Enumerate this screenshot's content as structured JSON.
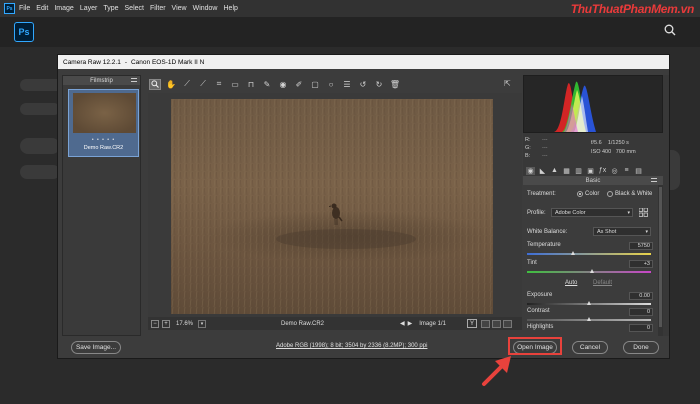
{
  "app": {
    "menu": [
      "File",
      "Edit",
      "Image",
      "Layer",
      "Type",
      "Select",
      "Filter",
      "View",
      "Window",
      "Help"
    ],
    "logo": "Ps",
    "watermark": "ThuThuatPhanMem.vn"
  },
  "dialog": {
    "title": "Camera Raw 12.2.1",
    "separator": "-",
    "camera": "Canon EOS-1D Mark II N",
    "filmstrip": {
      "header": "Filmstrip",
      "thumb_stars": "• • • • •",
      "thumb_name": "Demo Raw.CR2"
    },
    "status": {
      "minus": "−",
      "plus": "+",
      "zoom": "17.6%",
      "filename": "Demo Raw.CR2",
      "prev": "◀",
      "next": "▶",
      "image_count": "Image 1/1",
      "y_label": "Y"
    },
    "histogram_info": {
      "r_label": "R:",
      "g_label": "G:",
      "b_label": "B:",
      "r_val": "---",
      "g_val": "---",
      "b_val": "---",
      "aperture": "f/5.6",
      "shutter": "1/1250 s",
      "iso": "ISO 400",
      "focal": "700 mm"
    },
    "panel": {
      "header": "Basic",
      "treatment_label": "Treatment:",
      "treatment_color": "Color",
      "treatment_bw": "Black & White",
      "profile_label": "Profile:",
      "profile_value": "Adobe Color",
      "wb_label": "White Balance:",
      "wb_value": "As Shot",
      "temperature_label": "Temperature",
      "temperature_value": "5750",
      "tint_label": "Tint",
      "tint_value": "+3",
      "auto_label": "Auto",
      "default_label": "Default",
      "exposure_label": "Exposure",
      "exposure_value": "0.00",
      "contrast_label": "Contrast",
      "contrast_value": "0",
      "highlights_label": "Highlights",
      "highlights_value": "0"
    },
    "buttons": {
      "save": "Save Image...",
      "workflow": "Adobe RGB (1998); 8 bit; 3504 by 2336 (8.2MP); 300 ppi",
      "open": "Open Image",
      "cancel": "Cancel",
      "done": "Done"
    }
  },
  "colors": {
    "accent_highlight": "#e8423c",
    "ps_blue": "#31a8ff"
  }
}
